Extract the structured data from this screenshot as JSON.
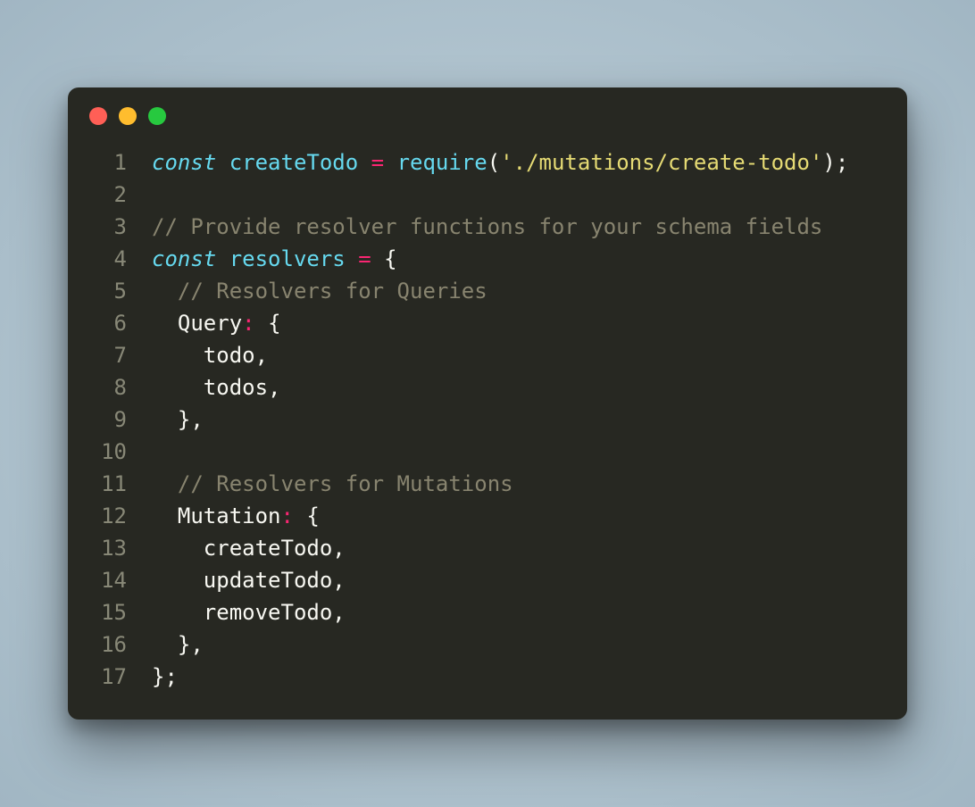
{
  "window": {
    "buttons": [
      "close",
      "minimize",
      "zoom"
    ]
  },
  "colors": {
    "background": "#272822",
    "keyword": "#66d9ef",
    "operator": "#f92672",
    "string": "#e6db74",
    "comment": "#88846f",
    "default": "#f8f8f2",
    "lineNumber": "#888877"
  },
  "code": {
    "lineCount": 17,
    "lines": [
      {
        "n": "1",
        "tokens": [
          {
            "c": "kw",
            "t": "const"
          },
          {
            "c": "ident",
            "t": " "
          },
          {
            "c": "func",
            "t": "createTodo"
          },
          {
            "c": "ident",
            "t": " "
          },
          {
            "c": "op",
            "t": "="
          },
          {
            "c": "ident",
            "t": " "
          },
          {
            "c": "func",
            "t": "require"
          },
          {
            "c": "punct",
            "t": "("
          },
          {
            "c": "str",
            "t": "'./mutations/create-todo'"
          },
          {
            "c": "punct",
            "t": ");"
          }
        ]
      },
      {
        "n": "2",
        "tokens": []
      },
      {
        "n": "3",
        "tokens": [
          {
            "c": "comment",
            "t": "// Provide resolver functions for your schema fields"
          }
        ]
      },
      {
        "n": "4",
        "tokens": [
          {
            "c": "kw",
            "t": "const"
          },
          {
            "c": "ident",
            "t": " "
          },
          {
            "c": "func",
            "t": "resolvers"
          },
          {
            "c": "ident",
            "t": " "
          },
          {
            "c": "op",
            "t": "="
          },
          {
            "c": "ident",
            "t": " "
          },
          {
            "c": "punct",
            "t": "{"
          }
        ]
      },
      {
        "n": "5",
        "tokens": [
          {
            "c": "ident",
            "t": "  "
          },
          {
            "c": "comment",
            "t": "// Resolvers for Queries"
          }
        ]
      },
      {
        "n": "6",
        "tokens": [
          {
            "c": "ident",
            "t": "  "
          },
          {
            "c": "key",
            "t": "Query"
          },
          {
            "c": "op",
            "t": ":"
          },
          {
            "c": "ident",
            "t": " "
          },
          {
            "c": "punct",
            "t": "{"
          }
        ]
      },
      {
        "n": "7",
        "tokens": [
          {
            "c": "ident",
            "t": "    todo"
          },
          {
            "c": "punct",
            "t": ","
          }
        ]
      },
      {
        "n": "8",
        "tokens": [
          {
            "c": "ident",
            "t": "    todos"
          },
          {
            "c": "punct",
            "t": ","
          }
        ]
      },
      {
        "n": "9",
        "tokens": [
          {
            "c": "ident",
            "t": "  "
          },
          {
            "c": "punct",
            "t": "},"
          }
        ]
      },
      {
        "n": "10",
        "tokens": []
      },
      {
        "n": "11",
        "tokens": [
          {
            "c": "ident",
            "t": "  "
          },
          {
            "c": "comment",
            "t": "// Resolvers for Mutations"
          }
        ]
      },
      {
        "n": "12",
        "tokens": [
          {
            "c": "ident",
            "t": "  "
          },
          {
            "c": "key",
            "t": "Mutation"
          },
          {
            "c": "op",
            "t": ":"
          },
          {
            "c": "ident",
            "t": " "
          },
          {
            "c": "punct",
            "t": "{"
          }
        ]
      },
      {
        "n": "13",
        "tokens": [
          {
            "c": "ident",
            "t": "    createTodo"
          },
          {
            "c": "punct",
            "t": ","
          }
        ]
      },
      {
        "n": "14",
        "tokens": [
          {
            "c": "ident",
            "t": "    updateTodo"
          },
          {
            "c": "punct",
            "t": ","
          }
        ]
      },
      {
        "n": "15",
        "tokens": [
          {
            "c": "ident",
            "t": "    removeTodo"
          },
          {
            "c": "punct",
            "t": ","
          }
        ]
      },
      {
        "n": "16",
        "tokens": [
          {
            "c": "ident",
            "t": "  "
          },
          {
            "c": "punct",
            "t": "},"
          }
        ]
      },
      {
        "n": "17",
        "tokens": [
          {
            "c": "punct",
            "t": "};"
          }
        ]
      }
    ]
  }
}
